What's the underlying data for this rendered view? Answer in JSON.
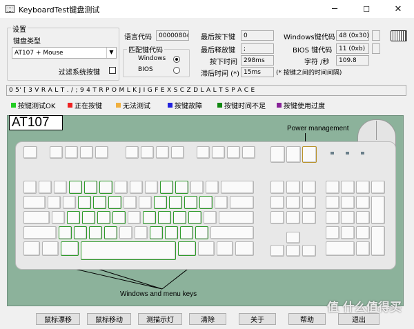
{
  "window": {
    "title": "KeyboardTest键盘测试",
    "minimize": "─",
    "maximize": "☐",
    "close": "✕"
  },
  "settings": {
    "group_label": "设置",
    "kb_type_label": "键盘类型",
    "kb_type_value": "AT107 + Mouse",
    "filter_label": "过滤系统按键",
    "lang_label": "语言代码",
    "lang_value": "00000804",
    "match_label": "匹配键代码",
    "windows_label": "Windows",
    "bios_label": "BIOS"
  },
  "stats": {
    "last_down_label": "最后按下键",
    "last_down_value": "0",
    "last_up_label": "最后释放键",
    "last_up_value": ";",
    "press_time_label": "按下时间",
    "press_time_value": "298ms",
    "delay_label": "滞后时间 (*)",
    "delay_value": "15ms",
    "win_code_label": "Windows键代码",
    "win_code_value": "48 (0x30)",
    "bios_code_label": "BIOS 键代码",
    "bios_code_value": "11 (0xb)",
    "cps_label": "字符 /秒",
    "cps_value": "109.8",
    "note": "(* 按键之间的时间间隔)"
  },
  "history": "0 5' [ 3 V R A L T . / ; 9 4 T R P O M L K J I G F E X S C Z D L A L T S P A C E",
  "legend": [
    {
      "label": "按键测试OK",
      "color": "#22cc22"
    },
    {
      "label": "正在按键",
      "color": "#ee2222"
    },
    {
      "label": "无法测试",
      "color": "#f0b040"
    },
    {
      "label": "按键故障",
      "color": "#2222dd"
    },
    {
      "label": "按键时间不足",
      "color": "#118811"
    },
    {
      "label": "按键使用过度",
      "color": "#882299"
    }
  ],
  "keyboard": {
    "model": "AT107",
    "power_label": "Power management",
    "win_menu_label": "Windows and menu keys"
  },
  "buttons": [
    "鼠标漂移",
    "鼠标移动",
    "测描示灯",
    "清除",
    "关于",
    "帮助",
    "退出"
  ],
  "watermark": "值 什么值得买"
}
